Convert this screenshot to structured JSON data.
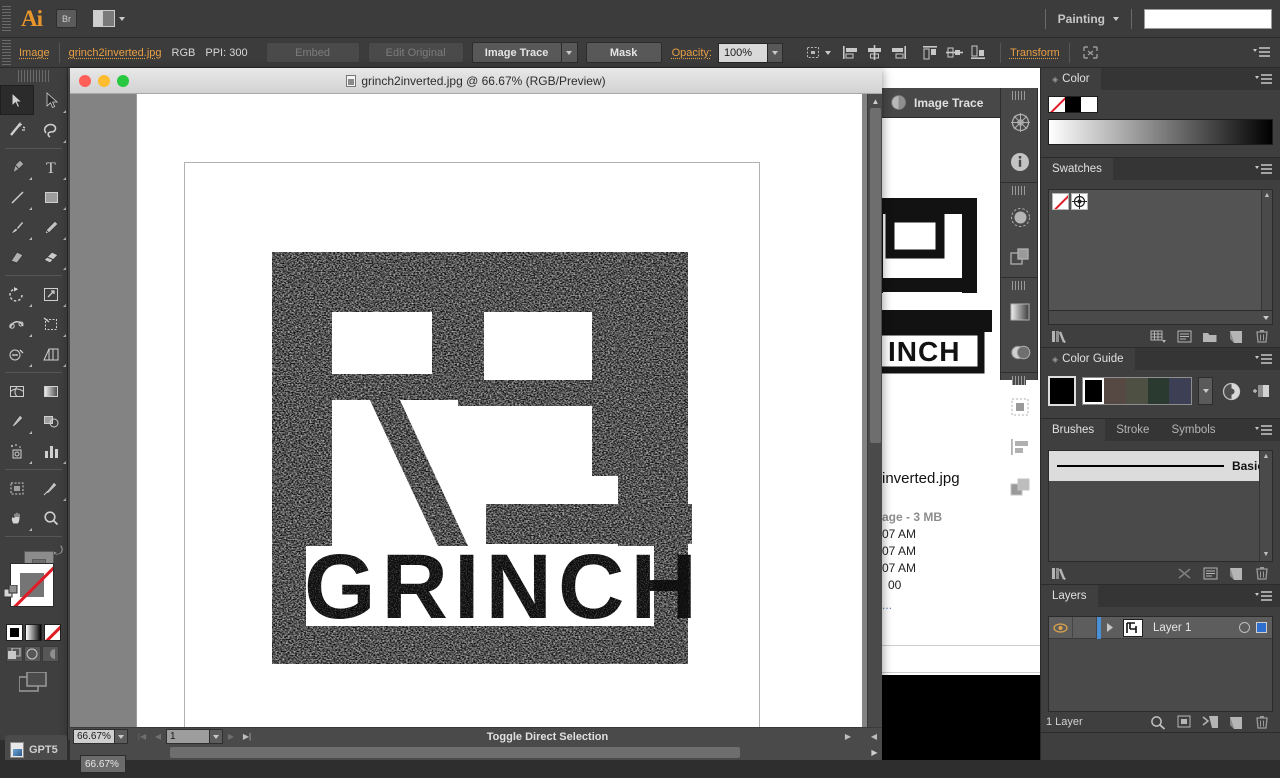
{
  "app": {
    "name": "Adobe Illustrator",
    "logo_text": "Ai",
    "bridge_button": "Br",
    "arrange_documents_label": "arrange-documents",
    "workspace": "Painting",
    "search_placeholder": ""
  },
  "control_bar": {
    "object_type": "Image",
    "file_name": "grinch2inverted.jpg",
    "color_mode": "RGB",
    "ppi": "PPI: 300",
    "embed_button": "Embed",
    "edit_original_button": "Edit Original",
    "image_trace_button": "Image Trace",
    "mask_button": "Mask",
    "opacity_label": "Opacity:",
    "opacity_value": "100%",
    "transform_label": "Transform",
    "align_icons": [
      "align-left-icon",
      "align-center-horizontal-icon",
      "align-right-icon",
      "align-top-icon",
      "align-center-vertical-icon",
      "align-bottom-icon"
    ]
  },
  "toolbar": {
    "tools": [
      "selection-tool",
      "direct-selection-tool",
      "magic-wand-tool",
      "lasso-tool",
      "pen-tool",
      "type-tool",
      "line-segment-tool",
      "rectangle-tool",
      "paintbrush-tool",
      "pencil-tool",
      "blob-brush-tool",
      "eraser-tool",
      "rotate-tool",
      "scale-tool",
      "width-tool",
      "free-transform-tool",
      "shape-builder-tool",
      "perspective-grid-tool",
      "mesh-tool",
      "gradient-tool",
      "eyedropper-tool",
      "blend-tool",
      "symbol-sprayer-tool",
      "column-graph-tool",
      "artboard-tool",
      "slice-tool",
      "hand-tool",
      "zoom-tool"
    ],
    "selected_tool": "selection-tool",
    "fill_color": "#757575",
    "stroke_color": "none",
    "fill_modes": [
      "color-fill",
      "gradient-fill",
      "none-fill"
    ],
    "drawing_modes": [
      "draw-normal",
      "draw-behind",
      "draw-inside"
    ],
    "screen_mode": "change-screen-mode"
  },
  "document": {
    "title": "grinch2inverted.jpg @ 66.67% (RGB/Preview)",
    "artwork_alt": "RPI GRINCH grunge logo",
    "zoom": "66.67%",
    "page_number": "1",
    "status_text": "Toggle Direct Selection"
  },
  "background_window": {
    "image_trace_tab": "Image Trace",
    "file_name": "inverted.jpg",
    "size_line": "age - 3 MB",
    "date_lines": [
      "07 AM",
      "07 AM",
      "07 AM"
    ],
    "extra_line": "00",
    "link_line": "..."
  },
  "icon_dock": {
    "icons": [
      "navigator-icon",
      "info-icon",
      "transparency-icon",
      "appearance-icon",
      "gradient-icon",
      "pathfinder-icon",
      "artboards-icon",
      "align-icon",
      "layers-stack-icon"
    ]
  },
  "panels": {
    "color": {
      "title": "Color",
      "swatches": [
        "none",
        "#000000",
        "#ffffff"
      ],
      "ramp_from": "#ffffff",
      "ramp_to": "#000000"
    },
    "swatches": {
      "title": "Swatches",
      "items": [
        "none-swatch",
        "registration-swatch"
      ],
      "footer_icons": [
        "swatch-libraries-icon",
        "show-kinds-icon",
        "swatch-options-icon",
        "new-group-icon",
        "new-swatch-icon",
        "delete-swatch-icon"
      ]
    },
    "color_guide": {
      "title": "Color Guide",
      "base_color": "#000000",
      "harmony_colors": [
        "#000000",
        "#564944",
        "#4e5044",
        "#2a3a30",
        "#3d3f55",
        "#e3e3e3"
      ],
      "icons": [
        "color-guide-options-icon",
        "edit-colors-icon"
      ]
    },
    "brushes": {
      "tabs": [
        "Brushes",
        "Stroke",
        "Symbols"
      ],
      "active_tab": "Brushes",
      "items": [
        {
          "label": "Basic",
          "type": "basic-stroke"
        }
      ],
      "footer_icons": [
        "brush-libraries-icon",
        "remove-brush-stroke-icon",
        "brush-options-icon",
        "new-brush-icon",
        "delete-brush-icon"
      ]
    },
    "layers": {
      "title": "Layers",
      "rows": [
        {
          "name": "Layer 1",
          "visible": true,
          "locked": false,
          "color": "#2f6fd0"
        }
      ],
      "count_label": "1 Layer",
      "footer_icons": [
        "locate-object-icon",
        "make-clipping-mask-icon",
        "create-new-sublayer-icon",
        "create-new-layer-icon",
        "delete-selection-icon"
      ]
    }
  },
  "taskbar": {
    "item_label": "GPT5",
    "zoom_tooltip": "66.67%"
  }
}
